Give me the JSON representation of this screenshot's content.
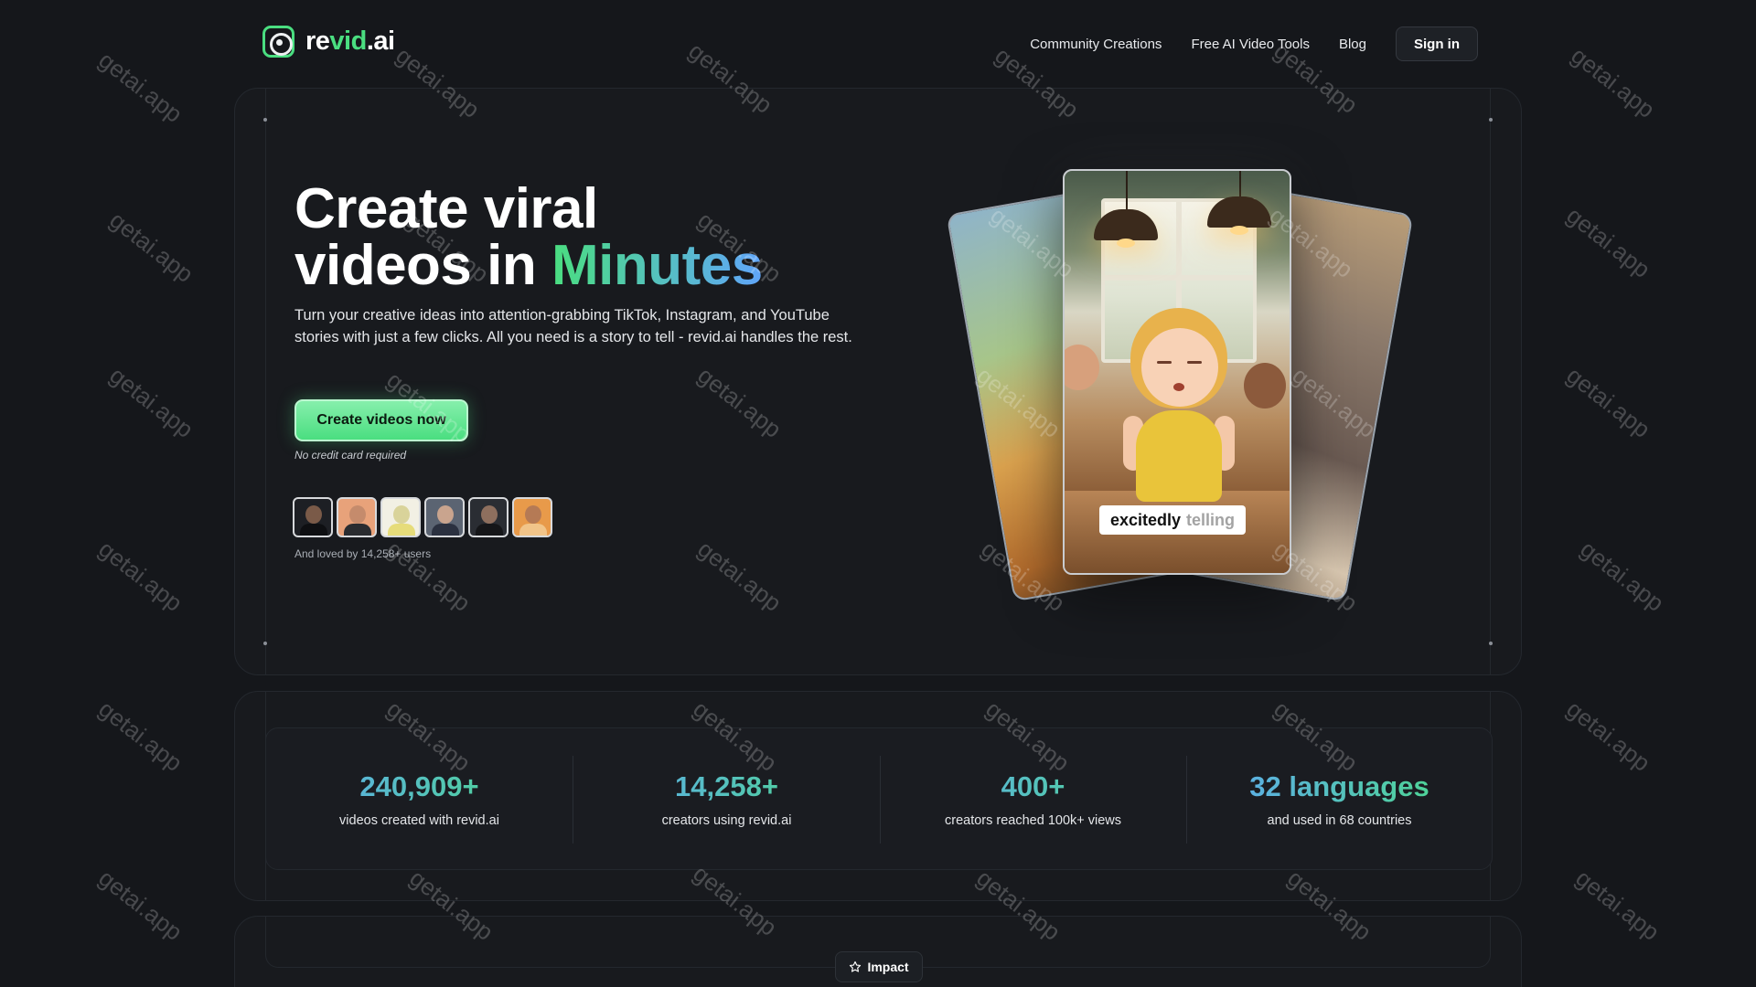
{
  "brand": {
    "prefix": "re",
    "accent": "vid",
    "suffix": ".ai"
  },
  "nav": {
    "links": [
      "Community Creations",
      "Free AI Video Tools",
      "Blog"
    ],
    "signin": "Sign in"
  },
  "hero": {
    "title_line1": "Create viral",
    "title_line2_plain": "videos in ",
    "title_line2_accent": "Minutes",
    "subtitle": "Turn your creative ideas into attention-grabbing TikTok, Instagram, and YouTube stories with just a few clicks. All you need is a story to tell - revid.ai handles the rest.",
    "cta": "Create videos now",
    "cta_note": "No credit card required",
    "loved": "And loved by 14,258+ users"
  },
  "preview": {
    "caption_word1": "excitedly",
    "caption_word2": "telling"
  },
  "stats": [
    {
      "value": "240,909+",
      "label": "videos created with revid.ai"
    },
    {
      "value": "14,258+",
      "label": "creators using revid.ai"
    },
    {
      "value": "400+",
      "label": "creators reached 100k+ views"
    },
    {
      "value": "32 languages",
      "label": "and used in 68 countries"
    }
  ],
  "impact_badge": "Impact",
  "watermark": "getai.app",
  "colors": {
    "accent_green": "#4ade80",
    "accent_blue": "#60a5fa",
    "background": "#15171b"
  }
}
